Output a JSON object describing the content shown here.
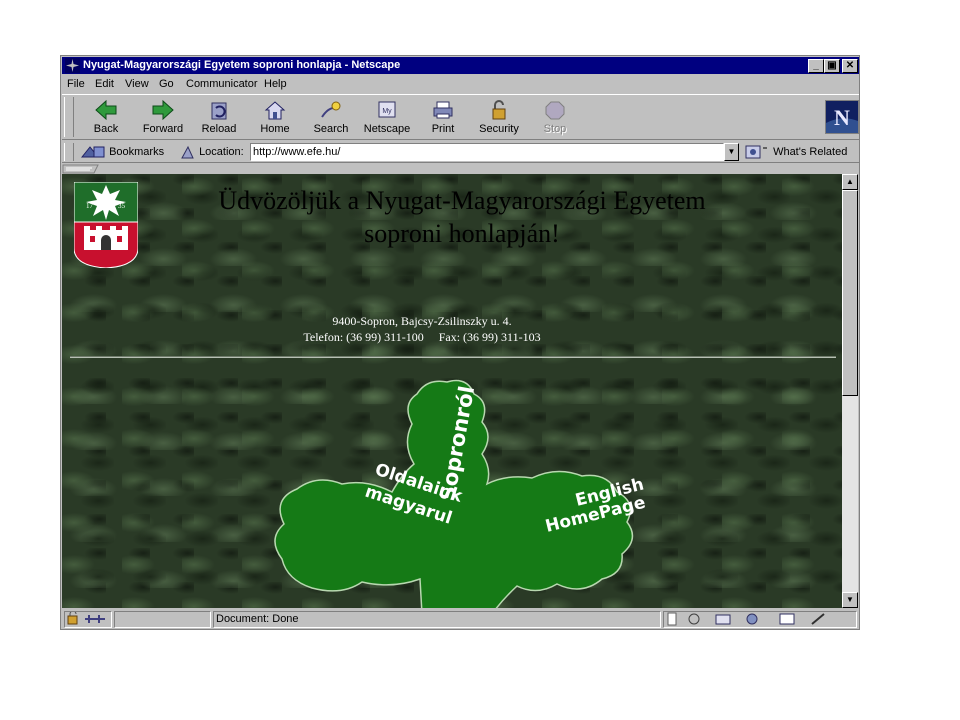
{
  "window": {
    "title": "Nyugat-Magyarországi Egyetem soproni honlapja - Netscape",
    "controls": {
      "minimize": "_",
      "maximize": "▣",
      "close": "✕"
    }
  },
  "menu": [
    "File",
    "Edit",
    "View",
    "Go",
    "Communicator",
    "Help"
  ],
  "toolbar": {
    "buttons": [
      {
        "label": "Back",
        "icon": "back-arrow-icon"
      },
      {
        "label": "Forward",
        "icon": "forward-arrow-icon"
      },
      {
        "label": "Reload",
        "icon": "reload-icon"
      },
      {
        "label": "Home",
        "icon": "home-icon"
      },
      {
        "label": "Search",
        "icon": "search-icon"
      },
      {
        "label": "Netscape",
        "icon": "netscape-my-icon"
      },
      {
        "label": "Print",
        "icon": "printer-icon"
      },
      {
        "label": "Security",
        "icon": "padlock-icon"
      },
      {
        "label": "Stop",
        "icon": "stop-icon",
        "disabled": true
      }
    ],
    "logo_letter": "N"
  },
  "location_bar": {
    "bookmarks_label": "Bookmarks",
    "location_label": "Location:",
    "url": "http://www.efe.hu/",
    "whats_related_label": "What's Related"
  },
  "page": {
    "heading_line1": "Üdvözöljük a Nyugat-Magyarországi Egyetem",
    "heading_line2": "soproni honlapján!",
    "address_line1": "9400-Sopron, Bajcsy-Zsilinszky u. 4.",
    "address_line2": "Telefon: (36 99) 311-100     Fax: (36 99) 311-103",
    "crest_year_left": "17",
    "crest_year_right": "35",
    "leaf_links": {
      "sopron": "Sopronról",
      "oldalaink_line1": "Oldalaink",
      "oldalaink_line2": "magyarul",
      "english_line1": "English",
      "english_line2": "HomePage"
    },
    "colors": {
      "leaf_green": "#157a16",
      "leaf_text": "#ffffff",
      "crest_green": "#1f6e2a",
      "crest_red": "#c8102e"
    }
  },
  "status": {
    "text": "Document: Done"
  }
}
